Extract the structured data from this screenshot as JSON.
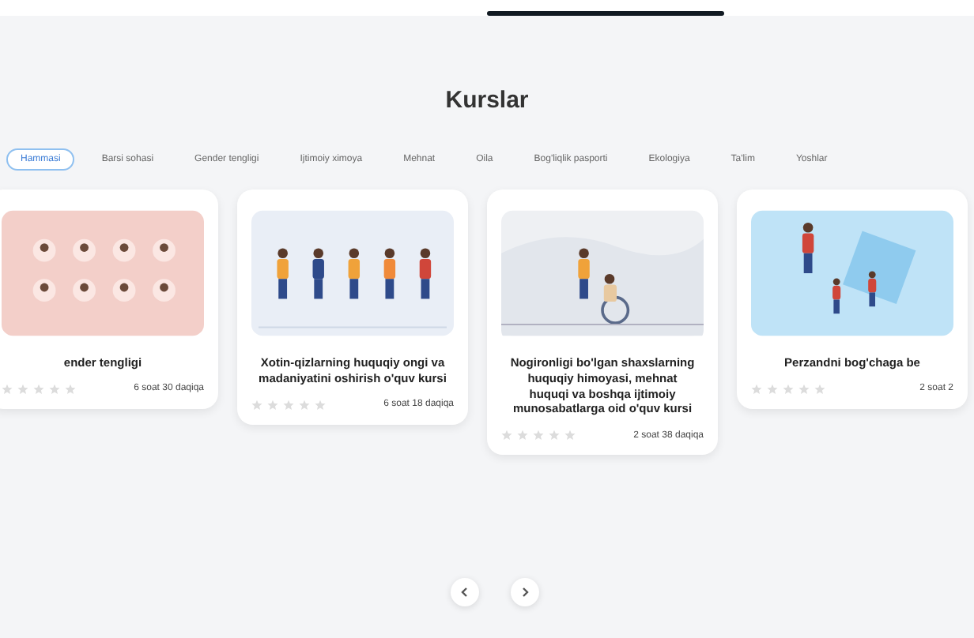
{
  "title": "Kurslar",
  "tabs": [
    {
      "label": "Hammasi",
      "selected": true
    },
    {
      "label": "Barsi sohasi",
      "selected": false
    },
    {
      "label": "Gender tengligi",
      "selected": false
    },
    {
      "label": "Ijtimoiy ximoya",
      "selected": false
    },
    {
      "label": "Mehnat",
      "selected": false
    },
    {
      "label": "Oila",
      "selected": false
    },
    {
      "label": "Bog'liqlik pasporti",
      "selected": false
    },
    {
      "label": "Ekologiya",
      "selected": false
    },
    {
      "label": "Ta'lim",
      "selected": false
    },
    {
      "label": "Yoshlar",
      "selected": false
    }
  ],
  "courses": [
    {
      "kind": "portraits",
      "title": "ender tengligi",
      "stars": 0,
      "duration": "6 soat 30 daqiqa"
    },
    {
      "kind": "crowd",
      "title": "Xotin-qizlarning huquqiy ongi va madaniyatini oshirish o'quv kursi",
      "stars": 0,
      "duration": "6 soat 18 daqiqa"
    },
    {
      "kind": "wheelchair",
      "title": "Nogironligi bo'lgan shaxslarning huquqiy himoyasi, mehnat huquqi va boshqa ijtimoiy munosabatlarga oid o'quv kursi",
      "stars": 0,
      "duration": "2 soat 38 daqiqa"
    },
    {
      "kind": "children",
      "title": "Perzandni bog'chaga be",
      "stars": 0,
      "duration": "2 soat 2"
    }
  ]
}
